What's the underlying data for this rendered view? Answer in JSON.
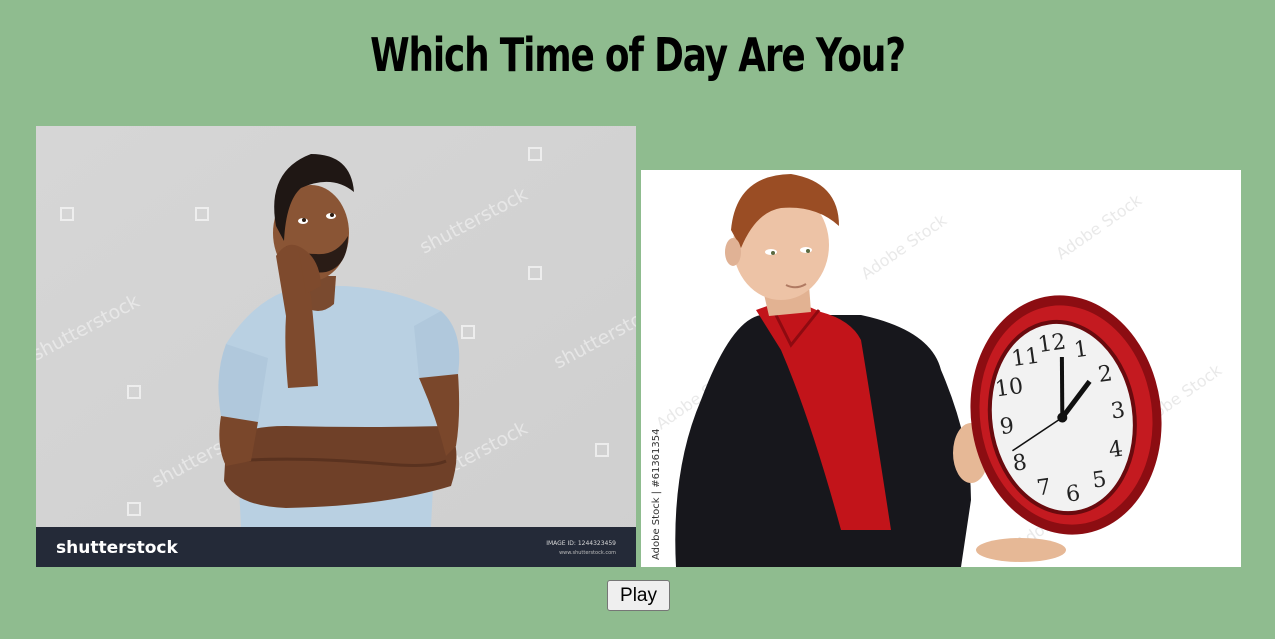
{
  "page": {
    "title": "Which Time of Day Are You?",
    "background_color": "#8fbc8f"
  },
  "options": [
    {
      "name": "thinking-man-photo",
      "watermark": "shutterstock",
      "footer_logo": "shutterstock",
      "image_id": "IMAGE ID: 1244323459",
      "site": "www.shutterstock.com"
    },
    {
      "name": "man-with-clock-photo",
      "watermark": "Adobe Stock",
      "credit": "Adobe Stock | #61361354",
      "clock_numbers": [
        "12",
        "1",
        "2",
        "3",
        "4",
        "5",
        "6",
        "7",
        "8",
        "9",
        "10",
        "11"
      ]
    }
  ],
  "controls": {
    "play_label": "Play"
  }
}
